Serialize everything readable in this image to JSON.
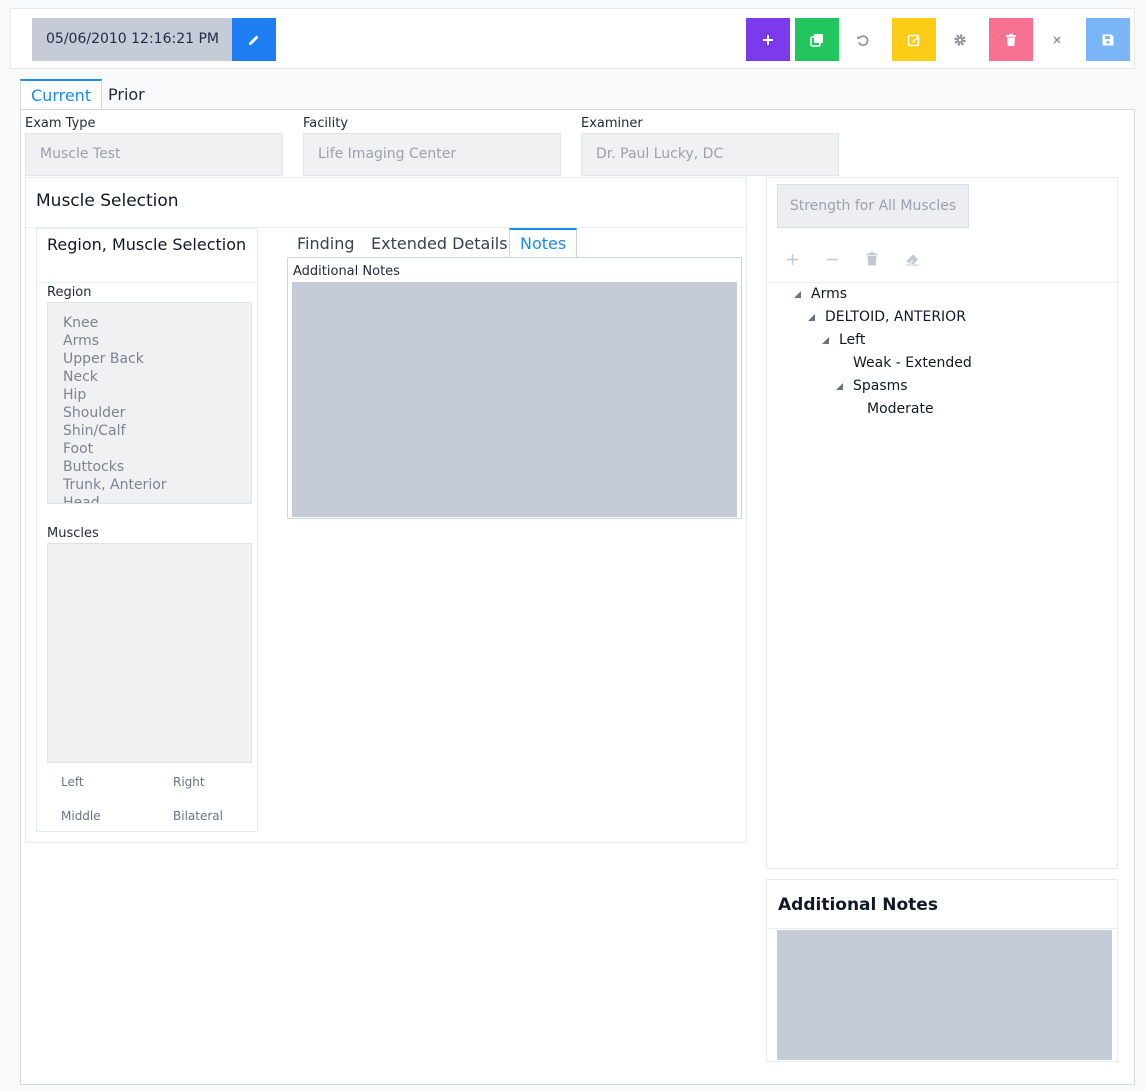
{
  "toolbar": {
    "datetime": "05/06/2010 12:16:21 PM",
    "buttons": [
      {
        "name": "add",
        "icon": "plus-icon",
        "color": "#7c3aed"
      },
      {
        "name": "copy",
        "icon": "copy-icon",
        "color": "#22c55e"
      },
      {
        "name": "undo",
        "icon": "undo-icon",
        "color": "transparent"
      },
      {
        "name": "edit",
        "icon": "edit-icon",
        "color": "#facc15"
      },
      {
        "name": "settings",
        "icon": "gear-icon",
        "color": "transparent"
      },
      {
        "name": "delete",
        "icon": "trash-icon",
        "color": "#f87190"
      },
      {
        "name": "close",
        "icon": "close-icon",
        "color": "transparent"
      },
      {
        "name": "save",
        "icon": "save-icon",
        "color": "#7ab6f7"
      }
    ]
  },
  "tabs": [
    "Current",
    "Prior"
  ],
  "fields": {
    "exam_type": {
      "label": "Exam Type",
      "value": "Muscle Test"
    },
    "facility": {
      "label": "Facility",
      "value": "Life Imaging Center"
    },
    "examiner": {
      "label": "Examiner",
      "value": "Dr. Paul Lucky, DC"
    }
  },
  "muscle_selection": {
    "title": "Muscle Selection",
    "region_panel_title": "Region, Muscle Selection",
    "region_label": "Region",
    "regions": [
      "Knee",
      "Arms",
      "Upper Back",
      "Neck",
      "Hip",
      "Shoulder",
      "Shin/Calf",
      "Foot",
      "Buttocks",
      "Trunk, Anterior",
      "Head"
    ],
    "muscles_label": "Muscles",
    "sides": [
      "Left",
      "Right",
      "Middle",
      "Bilateral"
    ]
  },
  "detail_tabs": [
    "Finding",
    "Extended Details",
    "Notes"
  ],
  "notes": {
    "label": "Additional Notes",
    "value": ""
  },
  "right": {
    "strength_button": "Strength for All Muscles",
    "tree": {
      "arms": "Arms",
      "deltoid": "DELTOID, ANTERIOR",
      "left": "Left",
      "weak": "Weak - Extended",
      "spasms": "Spasms",
      "moderate": "Moderate"
    },
    "additional_notes_title": "Additional Notes"
  },
  "colors": {
    "accent": "#1a8cf0",
    "edit_button": "#1e7ef2"
  }
}
